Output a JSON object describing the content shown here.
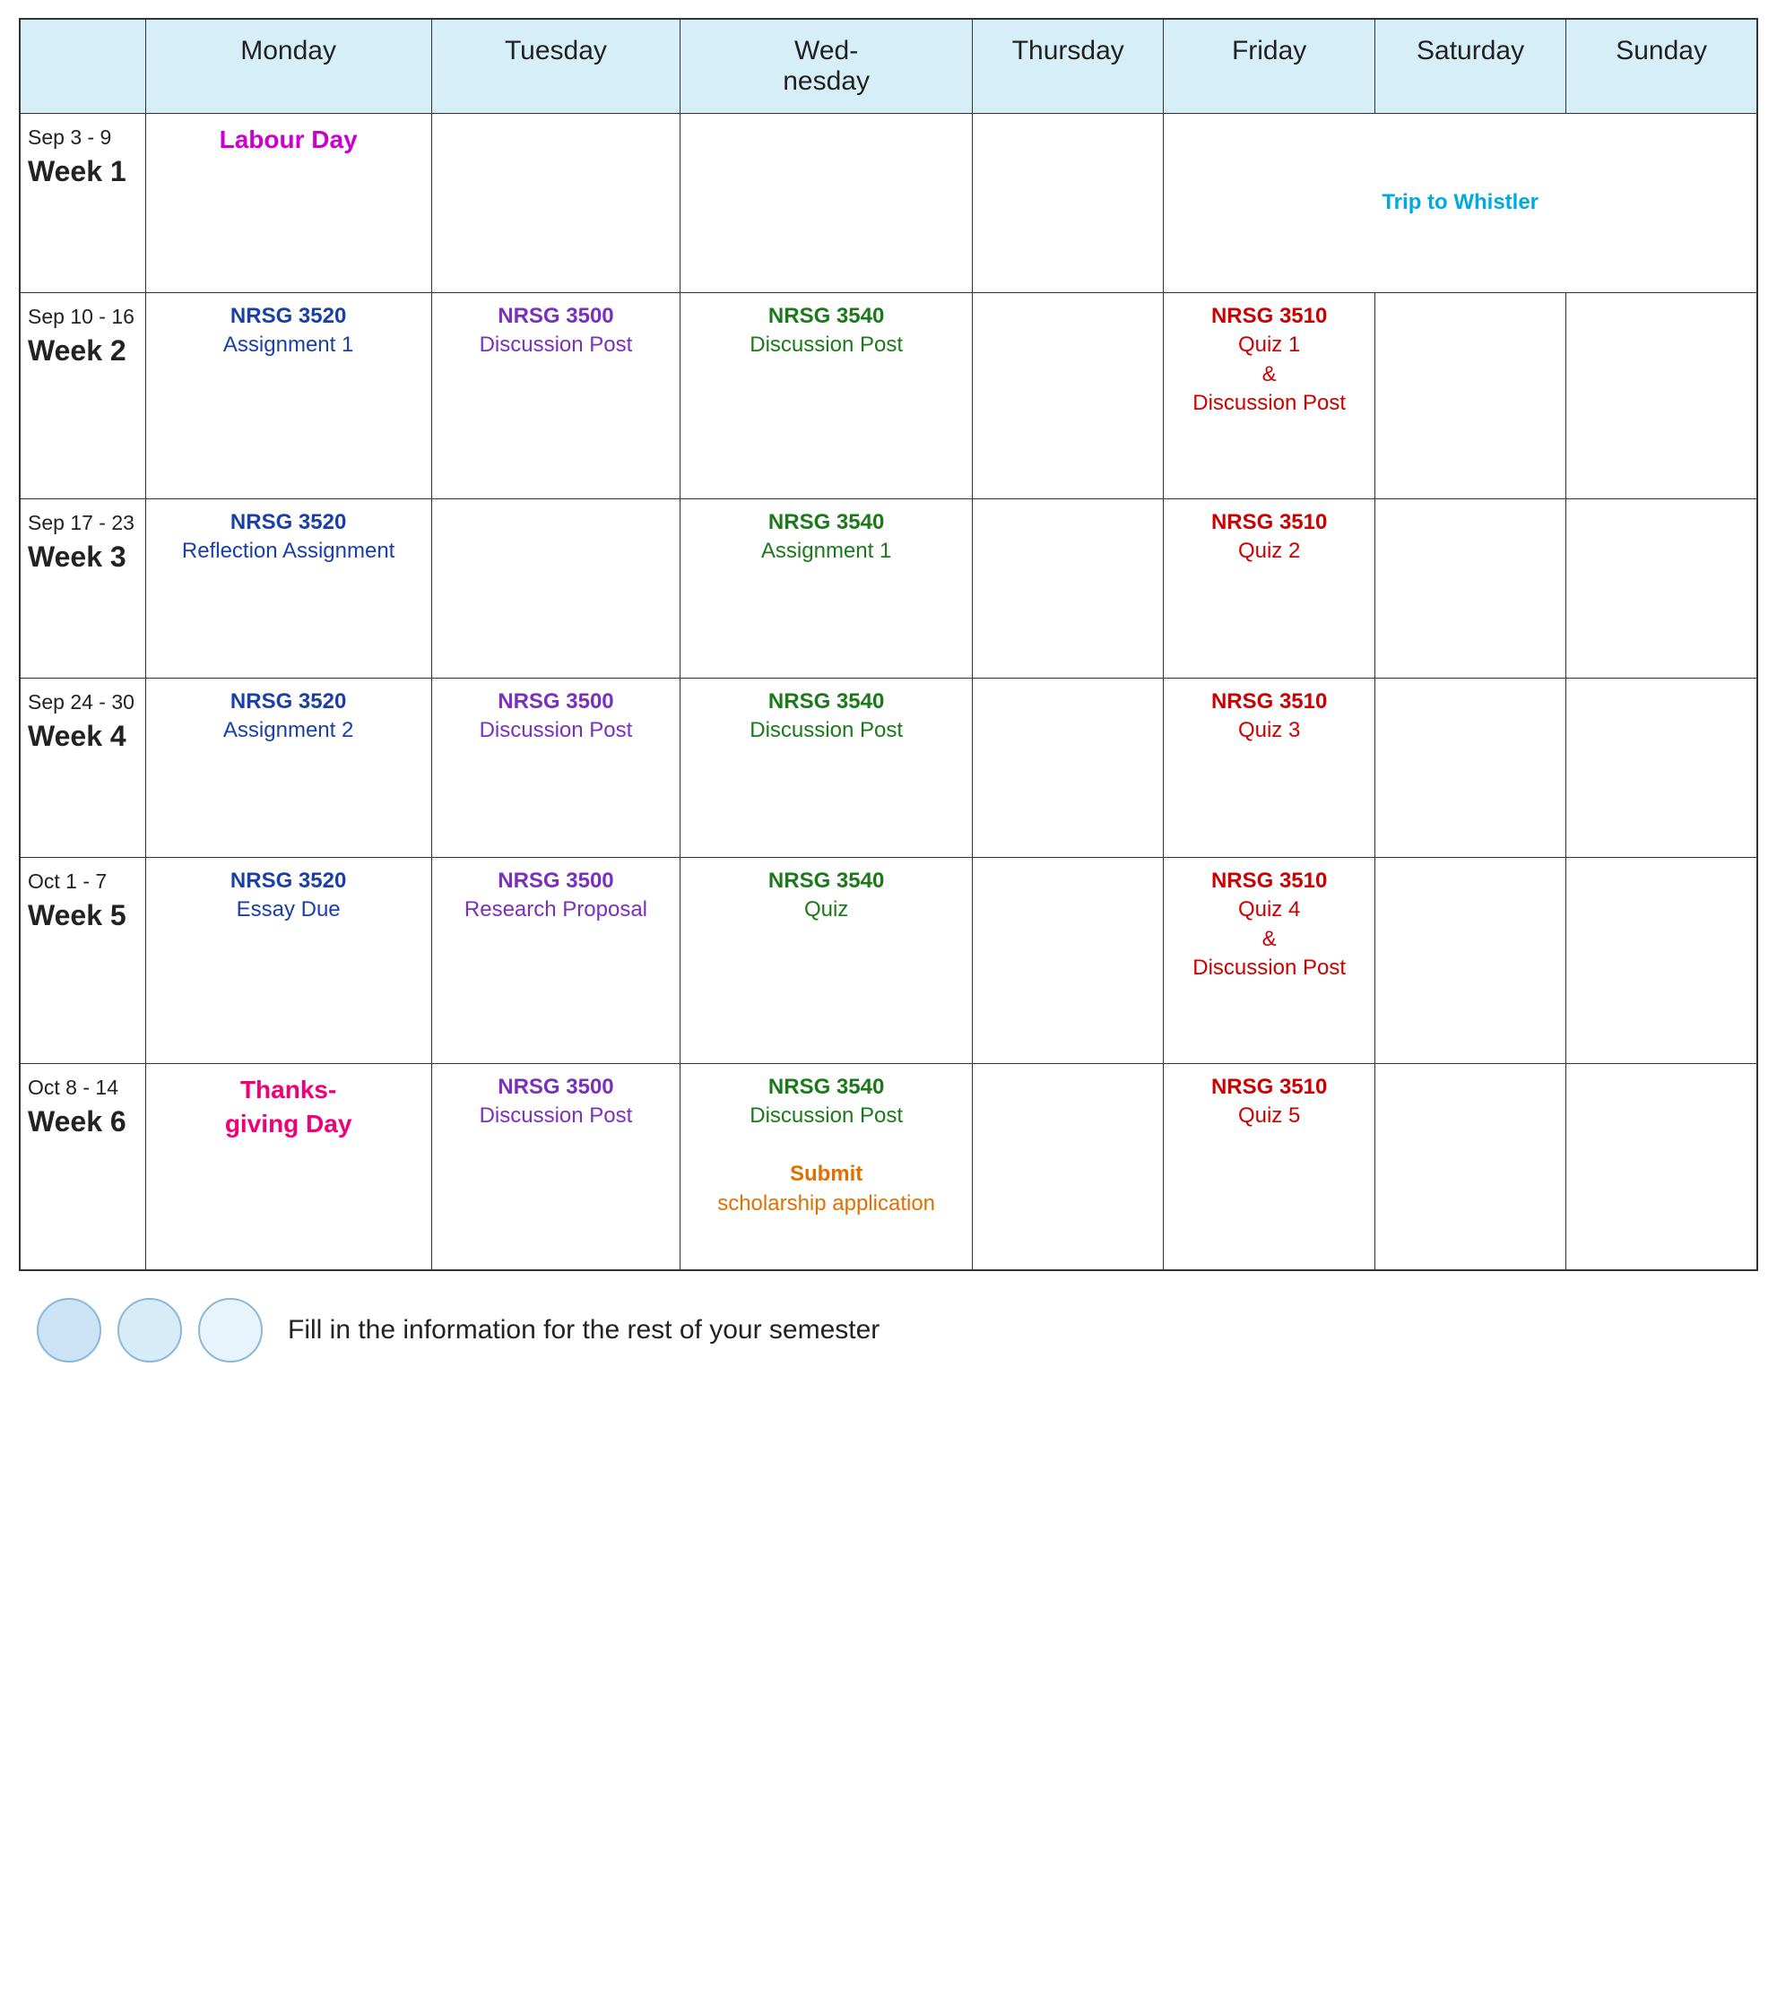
{
  "header": {
    "col0": "",
    "col1": "Monday",
    "col2": "Tuesday",
    "col3": "Wed-\nnesday",
    "col4": "Thursday",
    "col5": "Friday",
    "col6": "Saturday",
    "col7": "Sunday"
  },
  "weeks": [
    {
      "id": "week1",
      "date_range": "Sep 3 - 9",
      "week_label": "Week 1",
      "monday": {
        "text": "Labour Day",
        "color": "magenta"
      },
      "tuesday": {
        "text": "",
        "color": ""
      },
      "wednesday": {
        "text": "",
        "color": ""
      },
      "thursday": {
        "text": "",
        "color": ""
      },
      "friday_trip": true,
      "trip_text": "Trip to Whistler",
      "saturday": {
        "text": "",
        "color": ""
      },
      "sunday": {
        "text": "",
        "color": ""
      }
    },
    {
      "id": "week2",
      "date_range": "Sep 10 - 16",
      "week_label": "Week 2",
      "monday": {
        "title": "NRSG 3520",
        "sub": "Assignment 1",
        "color": "blue"
      },
      "tuesday": {
        "title": "NRSG 3500",
        "sub": "Discussion Post",
        "color": "purple"
      },
      "wednesday": {
        "title": "NRSG 3540",
        "sub": "Discussion Post",
        "color": "green"
      },
      "thursday": {
        "text": "",
        "color": ""
      },
      "friday": {
        "title": "NRSG 3510",
        "sub": "Quiz 1\n&\nDiscussion Post",
        "color": "red"
      },
      "saturday": {
        "text": "",
        "color": ""
      },
      "sunday": {
        "text": "",
        "color": ""
      }
    },
    {
      "id": "week3",
      "date_range": "Sep 17 - 23",
      "week_label": "Week 3",
      "monday": {
        "title": "NRSG 3520",
        "sub": "Reflection Assignment",
        "color": "blue"
      },
      "tuesday": {
        "text": "",
        "color": ""
      },
      "wednesday": {
        "title": "NRSG 3540",
        "sub": "Assignment 1",
        "color": "green"
      },
      "thursday": {
        "text": "",
        "color": ""
      },
      "friday": {
        "title": "NRSG 3510",
        "sub": "Quiz 2",
        "color": "red"
      },
      "saturday": {
        "text": "",
        "color": ""
      },
      "sunday": {
        "text": "",
        "color": ""
      }
    },
    {
      "id": "week4",
      "date_range": "Sep 24 - 30",
      "week_label": "Week 4",
      "monday": {
        "title": "NRSG 3520",
        "sub": "Assignment 2",
        "color": "blue"
      },
      "tuesday": {
        "title": "NRSG 3500",
        "sub": "Discussion Post",
        "color": "purple"
      },
      "wednesday": {
        "title": "NRSG 3540",
        "sub": "Discussion Post",
        "color": "green"
      },
      "thursday": {
        "text": "",
        "color": ""
      },
      "friday": {
        "title": "NRSG 3510",
        "sub": "Quiz 3",
        "color": "red"
      },
      "saturday": {
        "text": "",
        "color": ""
      },
      "sunday": {
        "text": "",
        "color": ""
      }
    },
    {
      "id": "week5",
      "date_range": "Oct 1 - 7",
      "week_label": "Week 5",
      "monday": {
        "title": "NRSG 3520",
        "sub": "Essay Due",
        "color": "blue"
      },
      "tuesday": {
        "title": "NRSG 3500",
        "sub": "Research Proposal",
        "color": "purple"
      },
      "wednesday": {
        "title": "NRSG 3540",
        "sub": "Quiz",
        "color": "green"
      },
      "thursday": {
        "text": "",
        "color": ""
      },
      "friday": {
        "title": "NRSG 3510",
        "sub": "Quiz 4\n&\nDiscussion Post",
        "color": "red"
      },
      "saturday": {
        "text": "",
        "color": ""
      },
      "sunday": {
        "text": "",
        "color": ""
      }
    },
    {
      "id": "week6",
      "date_range": "Oct 8 - 14",
      "week_label": "Week 6",
      "monday": {
        "title": "Thanks-\ngiving Day",
        "sub": "",
        "color": "pink-hot"
      },
      "tuesday": {
        "title": "NRSG 3500",
        "sub": "Discussion Post",
        "color": "purple"
      },
      "wednesday_multi": [
        {
          "title": "NRSG 3540",
          "sub": "Discussion Post",
          "color": "green"
        },
        {
          "title": "Submit",
          "sub": "scholarship application",
          "color": "orange"
        }
      ],
      "thursday": {
        "text": "",
        "color": ""
      },
      "friday": {
        "title": "NRSG 3510",
        "sub": "Quiz 5",
        "color": "red"
      },
      "saturday": {
        "text": "",
        "color": ""
      },
      "sunday": {
        "text": "",
        "color": ""
      }
    }
  ],
  "footer": {
    "fill_text": "Fill in the information for the rest of your semester"
  }
}
